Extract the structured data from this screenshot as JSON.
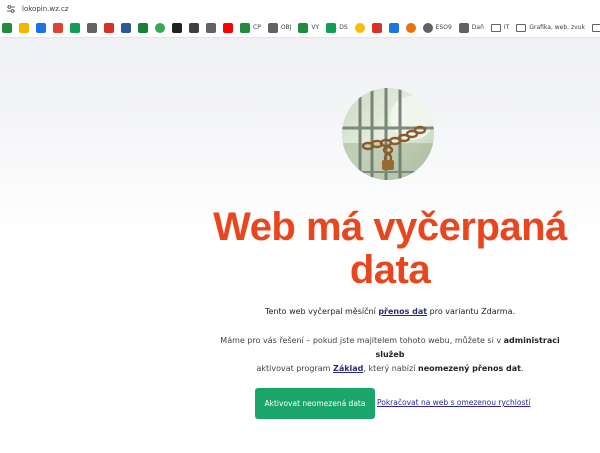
{
  "browser": {
    "url": "lokopin.wz.cz"
  },
  "bookmarks": [
    {
      "icon": "sheets-icon",
      "color": "#1e8e3e",
      "label": ""
    },
    {
      "icon": "pinwheel-icon",
      "color": "#f4b400",
      "label": ""
    },
    {
      "icon": "contacts-icon",
      "color": "#1a73e8",
      "label": ""
    },
    {
      "icon": "pin-icon",
      "color": "#db4437",
      "label": ""
    },
    {
      "icon": "drive-icon",
      "color": "#0f9d58",
      "label": ""
    },
    {
      "icon": "puzzle-icon",
      "color": "#5f6368",
      "label": ""
    },
    {
      "icon": "flag-icon",
      "color": "#d93025",
      "label": ""
    },
    {
      "icon": "word-icon",
      "color": "#2b579a",
      "label": ""
    },
    {
      "icon": "calendar-icon",
      "color": "#188038",
      "label": ""
    },
    {
      "icon": "green-circle-icon",
      "color": "#34a853",
      "label": ""
    },
    {
      "icon": "dark-app-icon",
      "color": "#202124",
      "label": ""
    },
    {
      "icon": "grid-app-icon",
      "color": "#3c4043",
      "label": ""
    },
    {
      "icon": "cursor-icon",
      "color": "#5f6368",
      "label": ""
    },
    {
      "icon": "youtube-icon",
      "color": "#ff0000",
      "label": ""
    },
    {
      "icon": "sheets-cp-icon",
      "color": "#1e8e3e",
      "label": "CP"
    },
    {
      "icon": "doc-obj-icon",
      "color": "#5f6368",
      "label": "OBJ"
    },
    {
      "icon": "sheets-vy-icon",
      "color": "#1e8e3e",
      "label": "VY"
    },
    {
      "icon": "drive-ds-icon",
      "color": "#0f9d58",
      "label": "DS"
    },
    {
      "icon": "ring-icon",
      "color": "#fbbc04",
      "label": ""
    },
    {
      "icon": "red-square-icon",
      "color": "#d93025",
      "label": ""
    },
    {
      "icon": "cz-flag-icon",
      "color": "#1a73e8",
      "label": ""
    },
    {
      "icon": "orange-circle-icon",
      "color": "#e8710a",
      "label": ""
    },
    {
      "icon": "globe-icon",
      "color": "#5f6368",
      "label": "ESO9"
    },
    {
      "icon": "doc-dane-icon",
      "color": "#5f6368",
      "label": "Daň"
    },
    {
      "icon": "folder-icon",
      "color": "#5f6368",
      "label": "IT"
    },
    {
      "icon": "folder-icon",
      "color": "#5f6368",
      "label": "Grafika, web, zvuk"
    },
    {
      "icon": "folder-icon",
      "color": "#5f6368",
      "label": ""
    }
  ],
  "page": {
    "headline": "Web má vyčerpaná data",
    "lead_before": "Tento web vyčerpal měsíční ",
    "lead_link": "přenos dat",
    "lead_after": " pro variantu Zdarma.",
    "info_part1": "Máme pro vás řešení – pokud jste majitelem tohoto webu, můžete si v ",
    "info_bold1": "administraci služeb",
    "info_part2": " aktivovat program ",
    "info_link": "Základ",
    "info_part3": ", který nabízí ",
    "info_bold2": "neomezený přenos dat",
    "info_part4": ".",
    "cta_label": "Aktivovat neomezená data",
    "continue_label": "Pokračovat na web s omezenou rychlostí"
  },
  "colors": {
    "headline": "#e8461f",
    "cta_bg": "#1aa56b",
    "link": "#2a2a7a"
  }
}
